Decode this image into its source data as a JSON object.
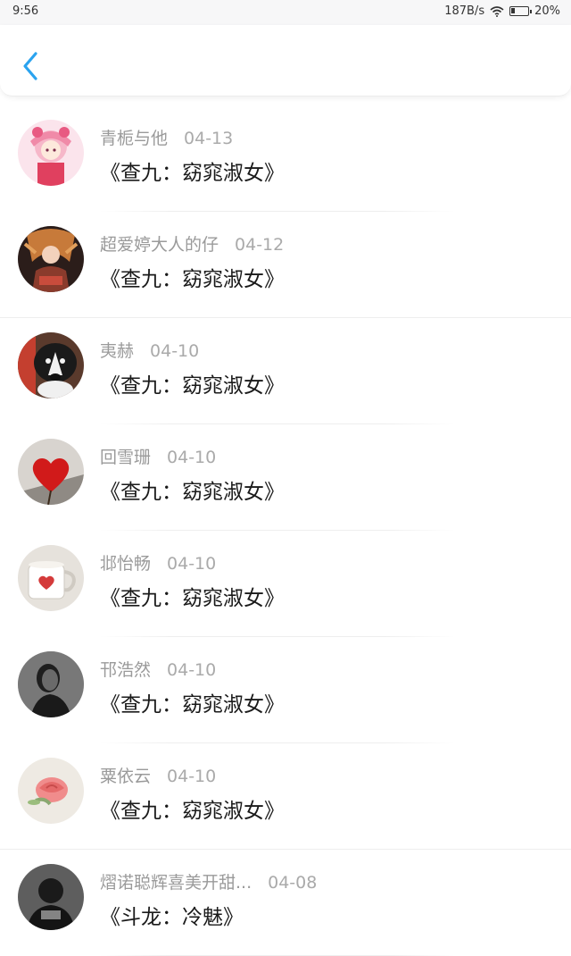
{
  "status_bar": {
    "time": "9:56",
    "net_speed": "187B/s",
    "battery": "20%"
  },
  "header": {
    "back_icon": "chevron-left-icon",
    "accent_color": "#2aa3ef"
  },
  "items": [
    {
      "name": "青栀与他",
      "date": "04-13",
      "title": "《查九：窈窕淑女》",
      "avatar": "anime-girl-pink"
    },
    {
      "name": "超爱婷大人的仔",
      "date": "04-12",
      "title": "《查九：窈窕淑女》",
      "avatar": "anime-girl-dark"
    },
    {
      "name": "夷赫",
      "date": "04-10",
      "title": "《查九：窈窕淑女》",
      "avatar": "husky-dog"
    },
    {
      "name": "回雪珊",
      "date": "04-10",
      "title": "《查九：窈窕淑女》",
      "avatar": "red-heart"
    },
    {
      "name": "邶怡畅",
      "date": "04-10",
      "title": "《查九：窈窕淑女》",
      "avatar": "heart-mug"
    },
    {
      "name": "邗浩然",
      "date": "04-10",
      "title": "《查九：窈窕淑女》",
      "avatar": "man-portrait-bw"
    },
    {
      "name": "粟依云",
      "date": "04-10",
      "title": "《查九：窈窕淑女》",
      "avatar": "pink-rose"
    },
    {
      "name": "熠诺聪辉喜美开甜...",
      "date": "04-08",
      "title": "《斗龙：冷魅》",
      "avatar": "person-dark"
    }
  ]
}
